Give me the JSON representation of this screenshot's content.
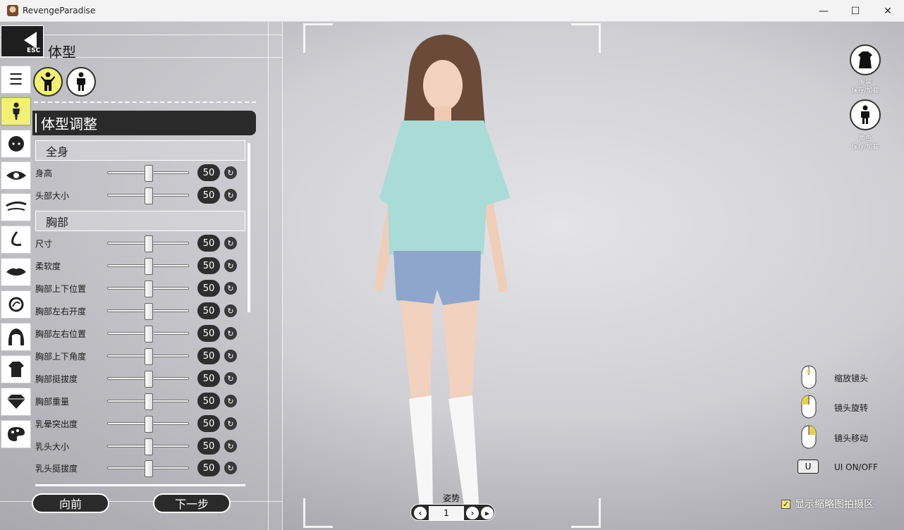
{
  "window": {
    "title": "RevengeParadise",
    "minimize_glyph": "—",
    "maximize_glyph": "☐",
    "close_glyph": "✕"
  },
  "header": {
    "esc_label": "ESC",
    "page_title": "体型"
  },
  "panel": {
    "section_title": "体型调整",
    "groups": [
      {
        "title": "全身"
      },
      {
        "title": "胸部"
      }
    ],
    "sliders": [
      {
        "label": "身高",
        "value": 50
      },
      {
        "label": "头部大小",
        "value": 50
      },
      {
        "label": "尺寸",
        "value": 50
      },
      {
        "label": "柔软度",
        "value": 50
      },
      {
        "label": "胸部上下位置",
        "value": 50
      },
      {
        "label": "胸部左右开度",
        "value": 50
      },
      {
        "label": "胸部左右位置",
        "value": 50
      },
      {
        "label": "胸部上下角度",
        "value": 50
      },
      {
        "label": "胸部挺拔度",
        "value": 50
      },
      {
        "label": "胸部重量",
        "value": 50
      },
      {
        "label": "乳晕突出度",
        "value": 50
      },
      {
        "label": "乳头大小",
        "value": 50
      },
      {
        "label": "乳头挺拔度",
        "value": 50
      }
    ],
    "slider_max": 100,
    "prev_button": "向前",
    "next_button": "下一步"
  },
  "right": {
    "outfit_label_1": "服装",
    "outfit_label_2": "保存/加载",
    "character_label_1": "角色",
    "character_label_2": "保存/加载",
    "help_zoom": "缩放镜头",
    "help_rotate": "镜头旋转",
    "help_move": "镜头移动",
    "ui_key": "U",
    "ui_toggle": "UI ON/OFF",
    "thumbnail_toggle": "显示缩略图拍摄区"
  },
  "pose": {
    "label": "姿势",
    "value": "1"
  },
  "colors": {
    "active_yellow": "#f2f070",
    "dark": "#2a2a2a"
  }
}
